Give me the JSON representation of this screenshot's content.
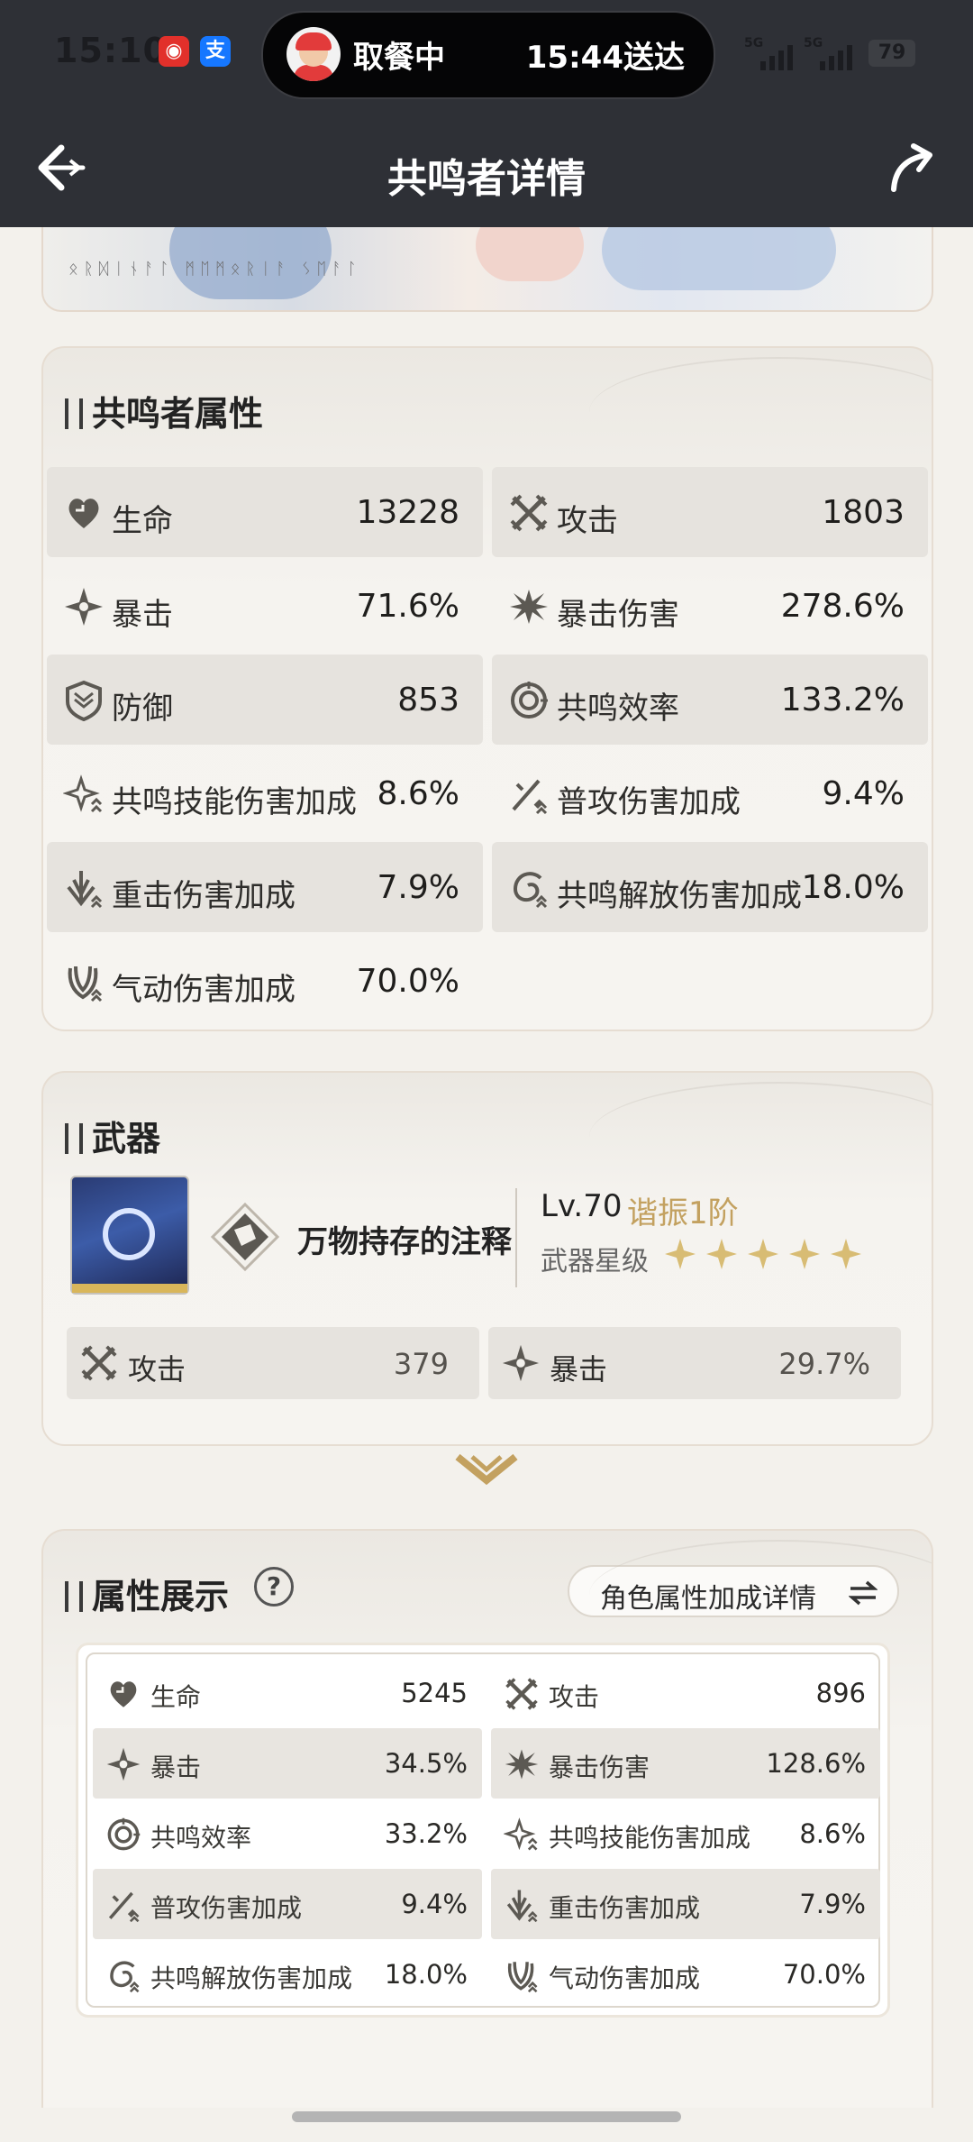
{
  "status_bar": {
    "time": "15:10",
    "activity_status": "取餐中",
    "activity_time": "15:44送达",
    "network": "5G",
    "battery": "79"
  },
  "nav": {
    "title": "共鸣者详情"
  },
  "hero": {
    "caption": "ᛟᚱᛞᛁᚾᚨᛚ ᛗᛖᛗᛟᚱᛁᚨ ᛊᛖᚨᛚ"
  },
  "attributes": {
    "title": "共鸣者属性",
    "stats": [
      {
        "icon": "heart-icon",
        "label": "生命",
        "value": "13228"
      },
      {
        "icon": "crossed-swords-icon",
        "label": "攻击",
        "value": "1803"
      },
      {
        "icon": "crit-star-icon",
        "label": "暴击",
        "value": "71.6%"
      },
      {
        "icon": "crit-burst-icon",
        "label": "暴击伤害",
        "value": "278.6%"
      },
      {
        "icon": "shield-icon",
        "label": "防御",
        "value": "853"
      },
      {
        "icon": "energy-ring-icon",
        "label": "共鸣效率",
        "value": "133.2%"
      },
      {
        "icon": "skill-star-icon",
        "label": "共鸣技能伤害加成",
        "value": "8.6%"
      },
      {
        "icon": "basic-attack-icon",
        "label": "普攻伤害加成",
        "value": "9.4%"
      },
      {
        "icon": "heavy-attack-icon",
        "label": "重击伤害加成",
        "value": "7.9%"
      },
      {
        "icon": "liberation-swirl-icon",
        "label": "共鸣解放伤害加成",
        "value": "18.0%"
      },
      {
        "icon": "aero-wind-icon",
        "label": "气动伤害加成",
        "value": "70.0%"
      }
    ]
  },
  "weapon": {
    "title": "武器",
    "name": "万物持存的注释",
    "level": "Lv.70",
    "tune": "谐振1阶",
    "star_label": "武器星级",
    "stars": 5,
    "stats": [
      {
        "icon": "crossed-swords-icon",
        "label": "攻击",
        "value": "379"
      },
      {
        "icon": "crit-star-icon",
        "label": "暴击",
        "value": "29.7%"
      }
    ]
  },
  "display": {
    "title": "属性展示",
    "help": "?",
    "detail_button": "角色属性加成详情",
    "stats": [
      {
        "icon": "heart-icon",
        "label": "生命",
        "value": "5245"
      },
      {
        "icon": "crossed-swords-icon",
        "label": "攻击",
        "value": "896"
      },
      {
        "icon": "crit-star-icon",
        "label": "暴击",
        "value": "34.5%"
      },
      {
        "icon": "crit-burst-icon",
        "label": "暴击伤害",
        "value": "128.6%"
      },
      {
        "icon": "energy-ring-icon",
        "label": "共鸣效率",
        "value": "33.2%"
      },
      {
        "icon": "skill-star-icon",
        "label": "共鸣技能伤害加成",
        "value": "8.6%"
      },
      {
        "icon": "basic-attack-icon",
        "label": "普攻伤害加成",
        "value": "9.4%"
      },
      {
        "icon": "heavy-attack-icon",
        "label": "重击伤害加成",
        "value": "7.9%"
      },
      {
        "icon": "liberation-swirl-icon",
        "label": "共鸣解放伤害加成",
        "value": "18.0%"
      },
      {
        "icon": "aero-wind-icon",
        "label": "气动伤害加成",
        "value": "70.0%"
      }
    ]
  },
  "colors": {
    "nav_background": "#2e3036",
    "accent_gold": "#c3a160",
    "row_shade": "#e6e3de"
  }
}
